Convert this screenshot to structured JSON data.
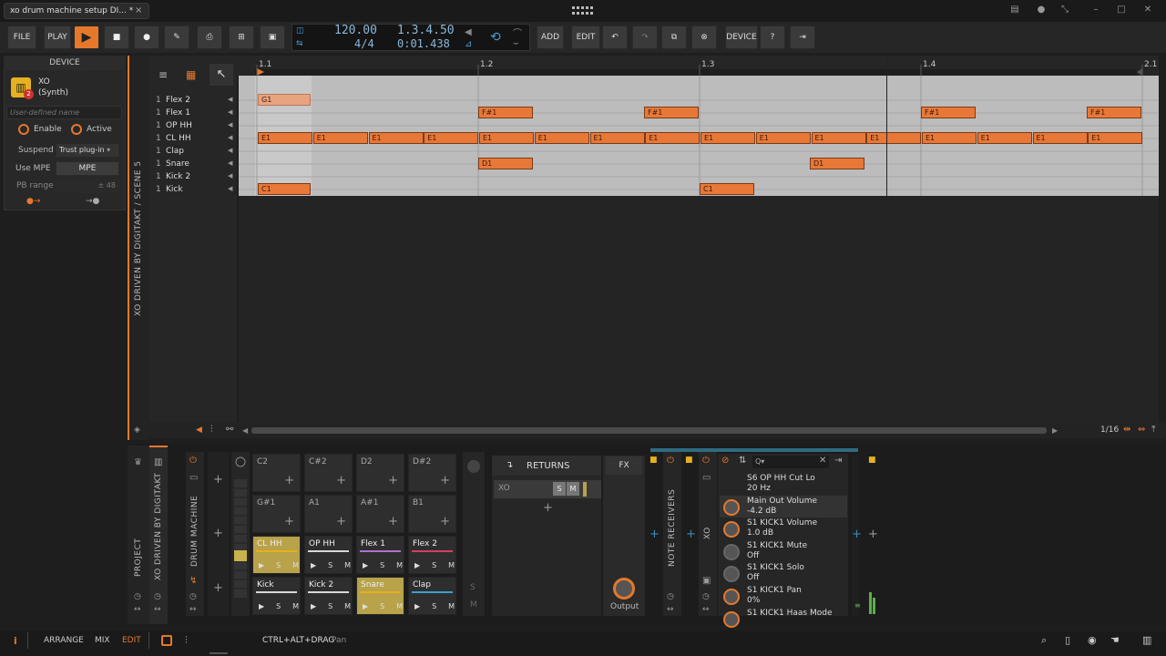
{
  "window": {
    "tab_title": "xo drum machine setup DI...",
    "tab_modified": "*",
    "tab_close": "×"
  },
  "toolbar": {
    "file": "FILE",
    "play": "PLAY",
    "add": "ADD",
    "edit": "EDIT",
    "device": "DEVICE",
    "tempo": "120.00",
    "time_sig": "4/4",
    "position": "1.3.4.50",
    "time": "0:01.438"
  },
  "device_panel": {
    "header": "DEVICE",
    "name": "XO",
    "type": "(Synth)",
    "name_placeholder": "User-defined name",
    "enable": "Enable",
    "active": "Active",
    "suspend_label": "Suspend",
    "suspend_value": "Trust plug-in",
    "mpe_label": "Use MPE",
    "mpe_value": "MPE",
    "pb_label": "PB range",
    "pb_value": "± 48"
  },
  "vertical_label": "XO DRIVEN BY DIGITAKT / SCENE 5",
  "ruler": [
    "1.1",
    "1.2",
    "1.3",
    "1.4",
    "2.1"
  ],
  "tracks": [
    {
      "num": "1",
      "name": "Flex 2"
    },
    {
      "num": "1",
      "name": "Flex 1"
    },
    {
      "num": "1",
      "name": "OP HH"
    },
    {
      "num": "1",
      "name": "CL HH"
    },
    {
      "num": "1",
      "name": "Clap"
    },
    {
      "num": "1",
      "name": "Snare"
    },
    {
      "num": "1",
      "name": "Kick 2"
    },
    {
      "num": "1",
      "name": "Kick"
    }
  ],
  "notes": {
    "g1": "G1",
    "fs1": "F#1",
    "e1": "E1",
    "d1": "D1",
    "c1": "C1"
  },
  "zoom": "1/16",
  "bottom": {
    "project": "PROJECT",
    "xo_driven": "XO DRIVEN BY DIGITAKT",
    "drum_machine": "DRUM MACHINE",
    "pads_top": [
      "C2",
      "C#2",
      "D2",
      "D#2",
      "G#1",
      "A1",
      "A#1",
      "B1"
    ],
    "pads": [
      "CL HH",
      "OP HH",
      "Flex 1",
      "Flex 2",
      "Kick",
      "Kick 2",
      "Snare",
      "Clap"
    ],
    "s": "S",
    "m": "M",
    "returns": "RETURNS",
    "fx": "FX",
    "return_xo": "XO",
    "output": "Output",
    "note_receivers": "NOTE RECEIVERS",
    "xo": "XO",
    "params": [
      {
        "name": "S6 OP HH Cut Lo",
        "value": "20 Hz"
      },
      {
        "name": "Main Out Volume",
        "value": "-4.2 dB"
      },
      {
        "name": "S1 KICK1 Volume",
        "value": "1.0 dB"
      },
      {
        "name": "S1 KICK1 Mute",
        "value": "Off"
      },
      {
        "name": "S1 KICK1 Solo",
        "value": "Off"
      },
      {
        "name": "S1 KICK1 Pan",
        "value": "0%"
      },
      {
        "name": "S1 KICK1 Haas Mode",
        "value": ""
      }
    ]
  },
  "statusbar": {
    "arrange": "ARRANGE",
    "mix": "MIX",
    "edit": "EDIT",
    "hint_key": "CTRL+ALT+DRAG",
    "hint_action": "Pan"
  },
  "colors": {
    "accent": "#e6782c",
    "note": "#e87838",
    "pad_yellow": "#b8a24a",
    "grid": "#bcbcbc"
  }
}
